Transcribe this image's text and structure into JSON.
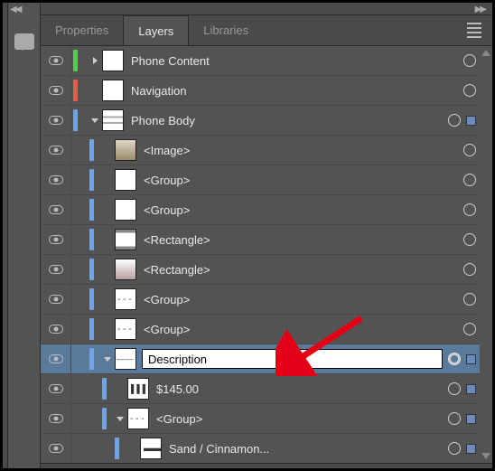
{
  "tabs": {
    "properties": "Properties",
    "layers": "Layers",
    "libraries": "Libraries"
  },
  "layers": {
    "r0": {
      "name": "Phone Content"
    },
    "r1": {
      "name": "Navigation"
    },
    "r2": {
      "name": "Phone Body"
    },
    "r3": {
      "name": "<Image>"
    },
    "r4": {
      "name": "<Group>"
    },
    "r5": {
      "name": "<Group>"
    },
    "r6": {
      "name": "<Rectangle>"
    },
    "r7": {
      "name": "<Rectangle>"
    },
    "r8": {
      "name": "<Group>"
    },
    "r9": {
      "name": "<Group>"
    },
    "r10": {
      "value": "Description"
    },
    "r11": {
      "name": "$145.00"
    },
    "r12": {
      "name": "<Group>"
    },
    "r13": {
      "name": "Sand / Cinnamon..."
    }
  }
}
